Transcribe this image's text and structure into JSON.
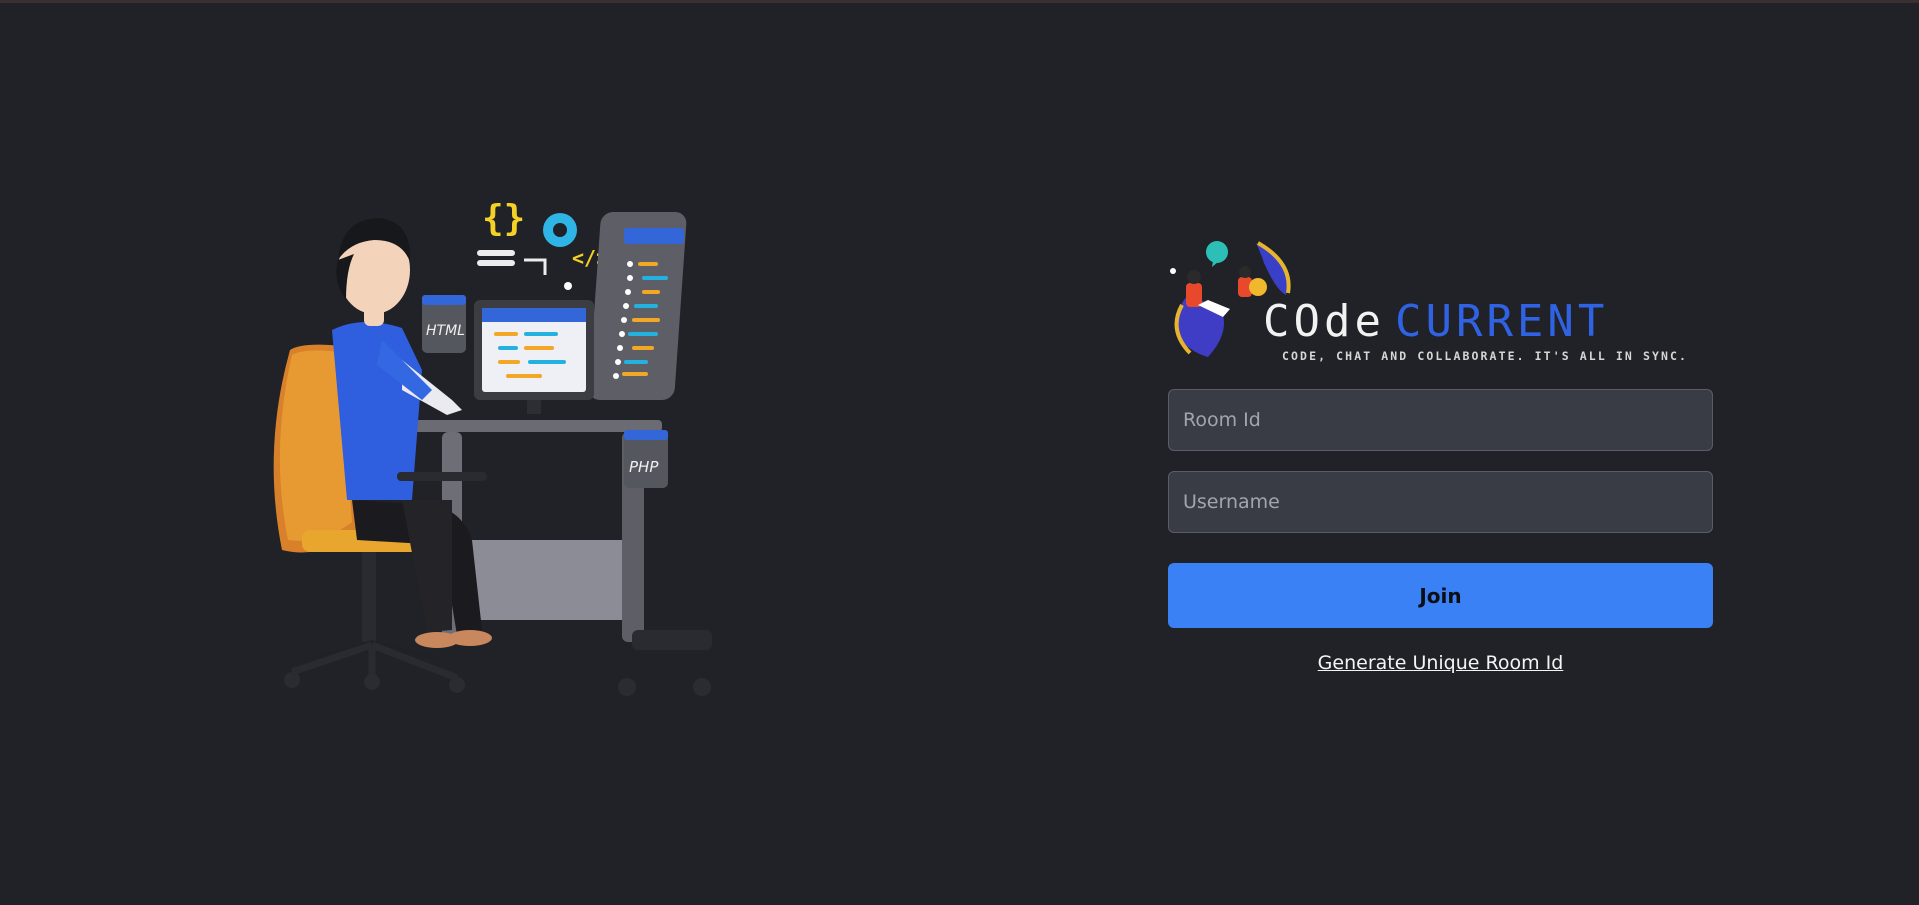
{
  "brand": {
    "word_primary": "COde",
    "word_secondary": "CURRENT",
    "tagline": "CODE, CHAT AND COLLABORATE. IT'S ALL IN SYNC."
  },
  "illustration": {
    "screen_label_html": "HTML",
    "screen_label_php": "PHP",
    "braces_label": "{}",
    "code_tag_label": "</>"
  },
  "form": {
    "room_id": {
      "placeholder": "Room Id",
      "value": ""
    },
    "username": {
      "placeholder": "Username",
      "value": ""
    },
    "join_label": "Join",
    "generate_label": "Generate Unique Room Id"
  },
  "colors": {
    "background": "#202227",
    "accent": "#3a81f6",
    "brand_blue": "#2f63e4",
    "field_bg": "#393b45"
  }
}
